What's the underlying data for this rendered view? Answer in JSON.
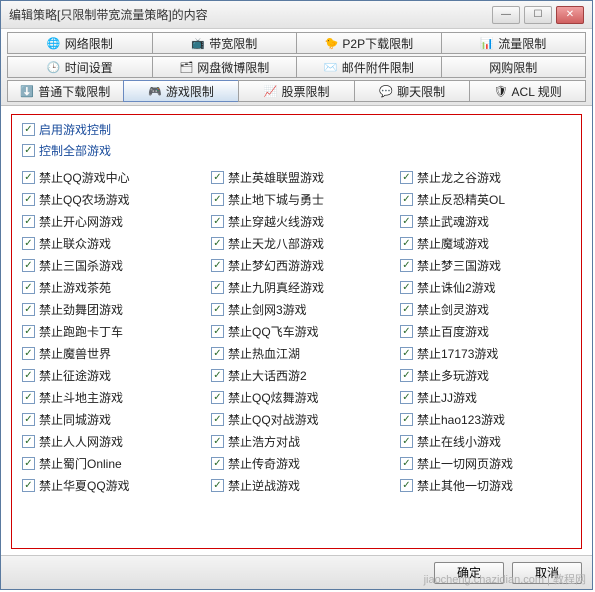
{
  "window": {
    "title": "编辑策略[只限制带宽流量策略]的内容"
  },
  "tabs": {
    "row1": [
      {
        "icon": "🌐",
        "label": "网络限制"
      },
      {
        "icon": "📺",
        "label": "带宽限制"
      },
      {
        "icon": "🐤",
        "label": "P2P下载限制"
      },
      {
        "icon": "📊",
        "label": "流量限制"
      }
    ],
    "row2": [
      {
        "icon": "🕒",
        "label": "时间设置"
      },
      {
        "icon": "🗂",
        "label": "网盘微博限制"
      },
      {
        "icon": "✉️",
        "label": "邮件附件限制"
      },
      {
        "icon": "",
        "label": "网购限制"
      }
    ],
    "row3": [
      {
        "icon": "⬇️",
        "label": "普通下载限制"
      },
      {
        "icon": "🎮",
        "label": "游戏限制",
        "active": true
      },
      {
        "icon": "📈",
        "label": "股票限制"
      },
      {
        "icon": "💬",
        "label": "聊天限制"
      },
      {
        "icon": "🛡",
        "label": "ACL 规则"
      }
    ]
  },
  "group": {
    "master1": "启用游戏控制",
    "master2": "控制全部游戏"
  },
  "columns": [
    [
      "禁止QQ游戏中心",
      "禁止QQ农场游戏",
      "禁止开心网游戏",
      "禁止联众游戏",
      "禁止三国杀游戏",
      "禁止游戏茶苑",
      "禁止劲舞团游戏",
      "禁止跑跑卡丁车",
      "禁止魔兽世界",
      "禁止征途游戏",
      "禁止斗地主游戏",
      "禁止同城游戏",
      "禁止人人网游戏",
      "禁止蜀门Online",
      "禁止华夏QQ游戏"
    ],
    [
      "禁止英雄联盟游戏",
      "禁止地下城与勇士",
      "禁止穿越火线游戏",
      "禁止天龙八部游戏",
      "禁止梦幻西游游戏",
      "禁止九阴真经游戏",
      "禁止剑网3游戏",
      "禁止QQ飞车游戏",
      "禁止热血江湖",
      "禁止大话西游2",
      "禁止QQ炫舞游戏",
      "禁止QQ对战游戏",
      "禁止浩方对战",
      "禁止传奇游戏",
      "禁止逆战游戏"
    ],
    [
      "禁止龙之谷游戏",
      "禁止反恐精英OL",
      "禁止武魂游戏",
      "禁止魔域游戏",
      "禁止梦三国游戏",
      "禁止诛仙2游戏",
      "禁止剑灵游戏",
      "禁止百度游戏",
      "禁止17173游戏",
      "禁止多玩游戏",
      "禁止JJ游戏",
      "禁止hao123游戏",
      "禁止在线小游戏",
      "禁止一切网页游戏",
      "禁止其他一切游戏"
    ]
  ],
  "footer": {
    "ok": "确定",
    "cancel": "取消"
  },
  "watermark": "jiaocheng.chazidian.com | 教程网"
}
